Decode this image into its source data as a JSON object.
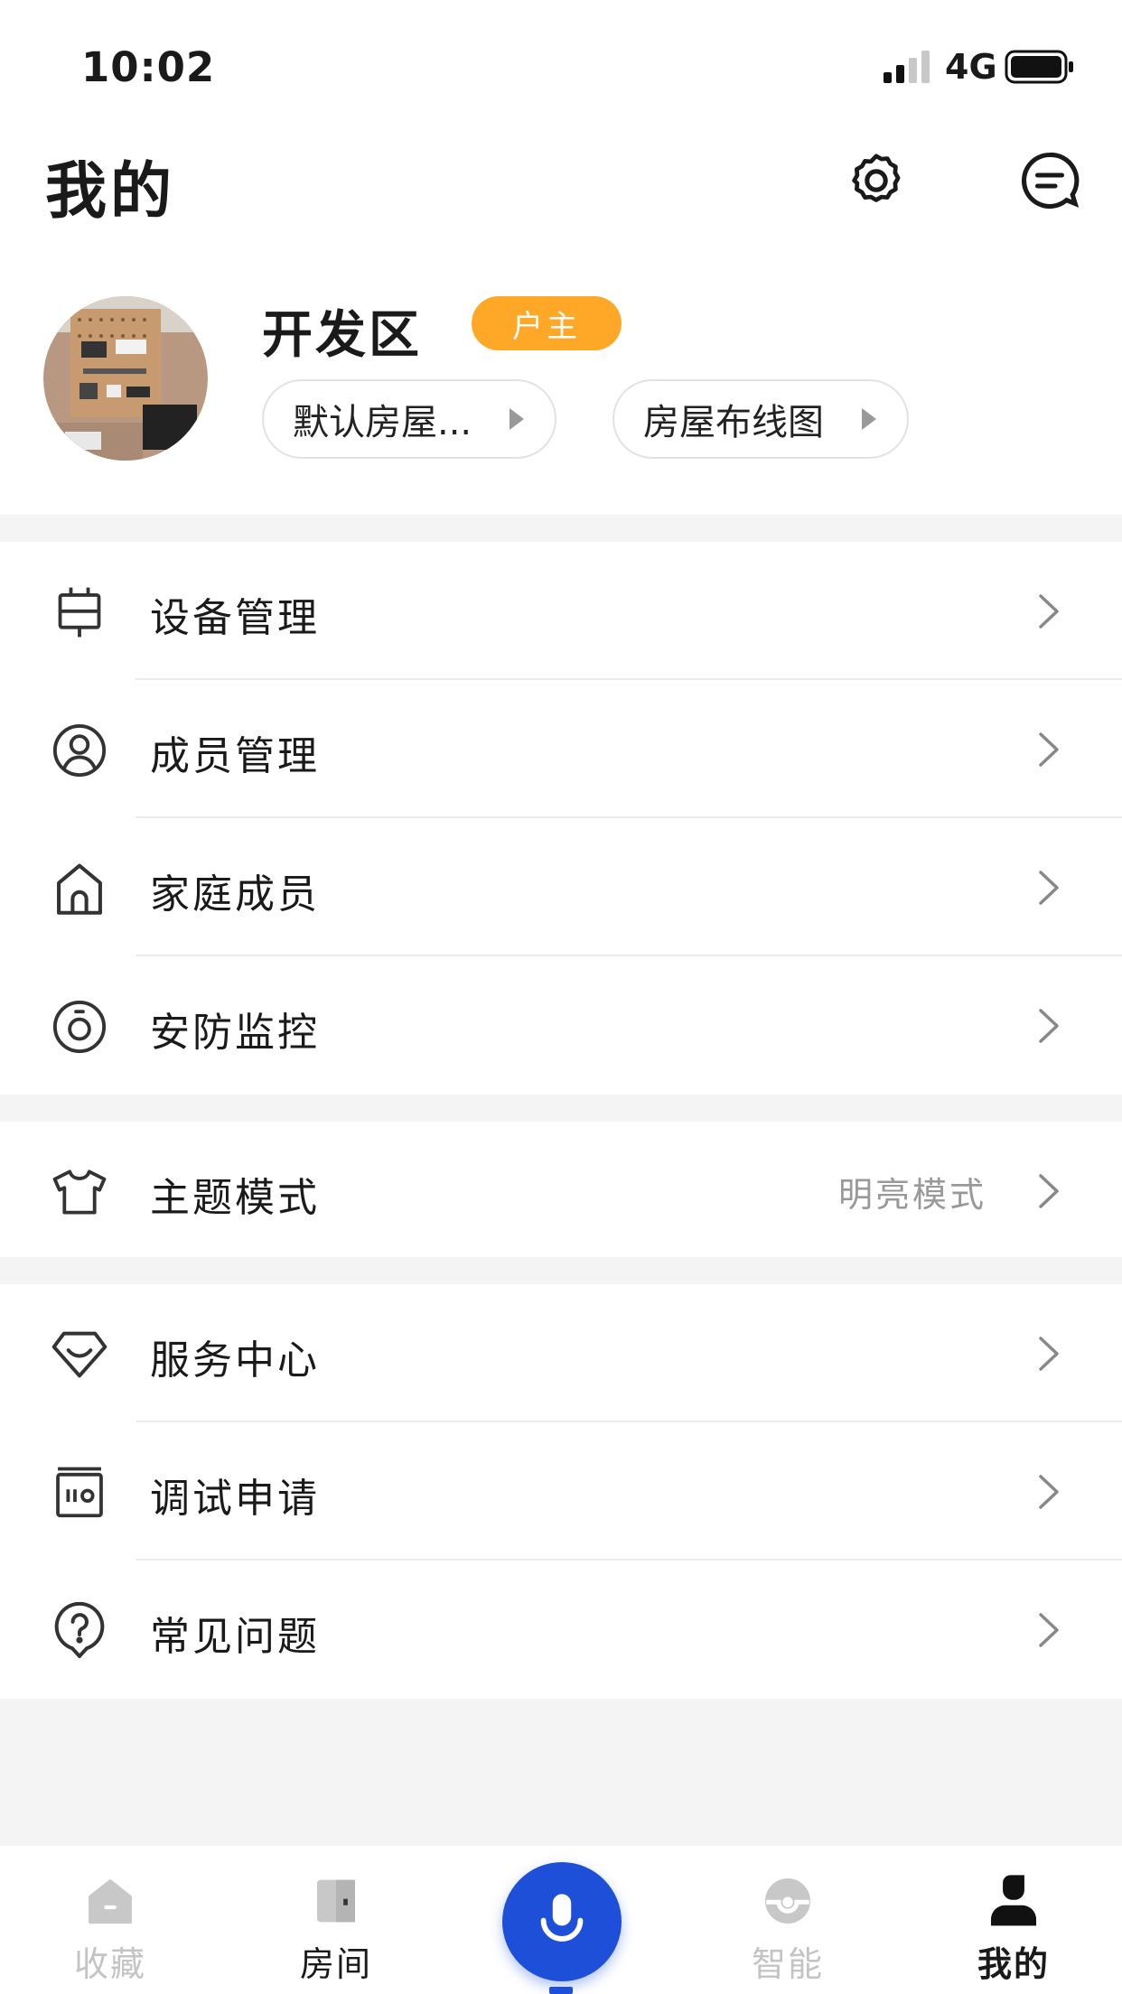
{
  "status_bar": {
    "time": "10:02",
    "network": "4G"
  },
  "header": {
    "title": "我的",
    "settings_icon": "gear-icon",
    "message_icon": "chat-icon"
  },
  "profile": {
    "home_name": "开发区",
    "role": "户主",
    "house_button": "默认房屋...",
    "wiring_button": "房屋布线图"
  },
  "menu": {
    "device": {
      "label": "设备管理",
      "icon": "device-icon"
    },
    "members": {
      "label": "成员管理",
      "icon": "user-circle-icon"
    },
    "family": {
      "label": "家庭成员",
      "icon": "house-icon"
    },
    "security": {
      "label": "安防监控",
      "icon": "camera-icon"
    },
    "theme": {
      "label": "主题模式",
      "value": "明亮模式",
      "icon": "shirt-icon"
    },
    "service": {
      "label": "服务中心",
      "icon": "diamond-icon"
    },
    "debug": {
      "label": "调试申请",
      "icon": "calendar-icon"
    },
    "faq": {
      "label": "常见问题",
      "icon": "question-icon"
    }
  },
  "tabbar": {
    "favorites": "收藏",
    "rooms": "房间",
    "smart": "智能",
    "mine": "我的"
  },
  "colors": {
    "badge": "#ffa726",
    "voice": "#1e4fd8",
    "background_gap": "#f4f4f4"
  }
}
